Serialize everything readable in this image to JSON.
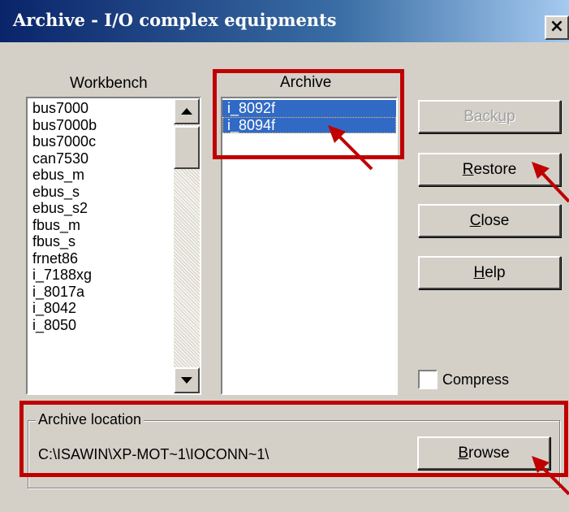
{
  "window": {
    "title": "Archive - I/O complex equipments",
    "close_label": "×"
  },
  "workbench": {
    "label": "Workbench",
    "items": [
      "bus7000",
      "bus7000b",
      "bus7000c",
      "can7530",
      "ebus_m",
      "ebus_s",
      "ebus_s2",
      "fbus_m",
      "fbus_s",
      "frnet86",
      "i_7188xg",
      "i_8017a",
      "i_8042",
      "i_8050"
    ]
  },
  "archive": {
    "label": "Archive",
    "items": [
      "i_8092f",
      "i_8094f"
    ],
    "selected": [
      "i_8092f",
      "i_8094f"
    ]
  },
  "buttons": {
    "backup": {
      "label": "Backup",
      "enabled": false
    },
    "restore": {
      "label": "Restore",
      "enabled": true
    },
    "close": {
      "label": "Close",
      "enabled": true
    },
    "help": {
      "label": "Help",
      "enabled": true
    },
    "browse": {
      "label": "Browse",
      "enabled": true
    }
  },
  "compress": {
    "label": "Compress",
    "checked": false
  },
  "archive_location": {
    "label": "Archive location",
    "path": "C:\\ISAWIN\\XP-MOT~1\\IOCONN~1\\"
  },
  "colors": {
    "annotation": "#c00000",
    "selection": "#316ac5",
    "face": "#d4d0c8"
  }
}
